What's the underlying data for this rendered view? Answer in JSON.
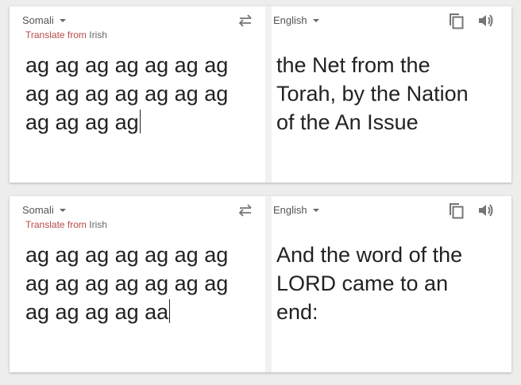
{
  "panels": [
    {
      "source_lang": "Somali",
      "detected_prefix": "Translate from ",
      "detected_lang": "Irish",
      "source_text": "ag ag ag ag ag ag ag\nag ag ag ag ag ag ag\nag ag ag ag",
      "target_lang": "English",
      "target_text": "the Net from the\nTorah, by the Nation\nof the An Issue"
    },
    {
      "source_lang": "Somali",
      "detected_prefix": "Translate from ",
      "detected_lang": "Irish",
      "source_text": "ag ag ag ag ag ag ag\nag ag ag ag ag ag ag\nag ag ag ag aa",
      "target_lang": "English",
      "target_text": "And the word of the\nLORD came to an\nend:"
    }
  ],
  "icons": {
    "swap": "swap-languages-icon",
    "copy": "copy-icon",
    "speaker": "speaker-icon"
  },
  "colors": {
    "detected_prefix": "#b84a4a",
    "icon": "#757575"
  }
}
